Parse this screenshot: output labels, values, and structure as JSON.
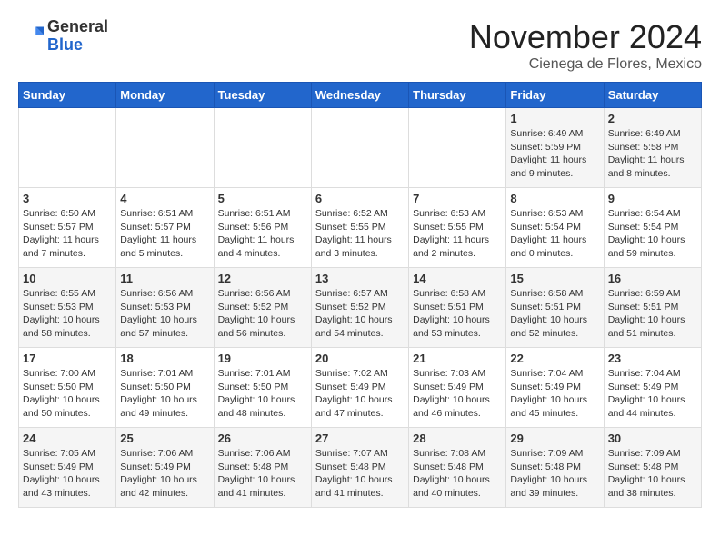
{
  "header": {
    "logo_general": "General",
    "logo_blue": "Blue",
    "month_title": "November 2024",
    "location": "Cienega de Flores, Mexico"
  },
  "weekdays": [
    "Sunday",
    "Monday",
    "Tuesday",
    "Wednesday",
    "Thursday",
    "Friday",
    "Saturday"
  ],
  "weeks": [
    [
      {
        "day": "",
        "info": ""
      },
      {
        "day": "",
        "info": ""
      },
      {
        "day": "",
        "info": ""
      },
      {
        "day": "",
        "info": ""
      },
      {
        "day": "",
        "info": ""
      },
      {
        "day": "1",
        "info": "Sunrise: 6:49 AM\nSunset: 5:59 PM\nDaylight: 11 hours and 9 minutes."
      },
      {
        "day": "2",
        "info": "Sunrise: 6:49 AM\nSunset: 5:58 PM\nDaylight: 11 hours and 8 minutes."
      }
    ],
    [
      {
        "day": "3",
        "info": "Sunrise: 6:50 AM\nSunset: 5:57 PM\nDaylight: 11 hours and 7 minutes."
      },
      {
        "day": "4",
        "info": "Sunrise: 6:51 AM\nSunset: 5:57 PM\nDaylight: 11 hours and 5 minutes."
      },
      {
        "day": "5",
        "info": "Sunrise: 6:51 AM\nSunset: 5:56 PM\nDaylight: 11 hours and 4 minutes."
      },
      {
        "day": "6",
        "info": "Sunrise: 6:52 AM\nSunset: 5:55 PM\nDaylight: 11 hours and 3 minutes."
      },
      {
        "day": "7",
        "info": "Sunrise: 6:53 AM\nSunset: 5:55 PM\nDaylight: 11 hours and 2 minutes."
      },
      {
        "day": "8",
        "info": "Sunrise: 6:53 AM\nSunset: 5:54 PM\nDaylight: 11 hours and 0 minutes."
      },
      {
        "day": "9",
        "info": "Sunrise: 6:54 AM\nSunset: 5:54 PM\nDaylight: 10 hours and 59 minutes."
      }
    ],
    [
      {
        "day": "10",
        "info": "Sunrise: 6:55 AM\nSunset: 5:53 PM\nDaylight: 10 hours and 58 minutes."
      },
      {
        "day": "11",
        "info": "Sunrise: 6:56 AM\nSunset: 5:53 PM\nDaylight: 10 hours and 57 minutes."
      },
      {
        "day": "12",
        "info": "Sunrise: 6:56 AM\nSunset: 5:52 PM\nDaylight: 10 hours and 56 minutes."
      },
      {
        "day": "13",
        "info": "Sunrise: 6:57 AM\nSunset: 5:52 PM\nDaylight: 10 hours and 54 minutes."
      },
      {
        "day": "14",
        "info": "Sunrise: 6:58 AM\nSunset: 5:51 PM\nDaylight: 10 hours and 53 minutes."
      },
      {
        "day": "15",
        "info": "Sunrise: 6:58 AM\nSunset: 5:51 PM\nDaylight: 10 hours and 52 minutes."
      },
      {
        "day": "16",
        "info": "Sunrise: 6:59 AM\nSunset: 5:51 PM\nDaylight: 10 hours and 51 minutes."
      }
    ],
    [
      {
        "day": "17",
        "info": "Sunrise: 7:00 AM\nSunset: 5:50 PM\nDaylight: 10 hours and 50 minutes."
      },
      {
        "day": "18",
        "info": "Sunrise: 7:01 AM\nSunset: 5:50 PM\nDaylight: 10 hours and 49 minutes."
      },
      {
        "day": "19",
        "info": "Sunrise: 7:01 AM\nSunset: 5:50 PM\nDaylight: 10 hours and 48 minutes."
      },
      {
        "day": "20",
        "info": "Sunrise: 7:02 AM\nSunset: 5:49 PM\nDaylight: 10 hours and 47 minutes."
      },
      {
        "day": "21",
        "info": "Sunrise: 7:03 AM\nSunset: 5:49 PM\nDaylight: 10 hours and 46 minutes."
      },
      {
        "day": "22",
        "info": "Sunrise: 7:04 AM\nSunset: 5:49 PM\nDaylight: 10 hours and 45 minutes."
      },
      {
        "day": "23",
        "info": "Sunrise: 7:04 AM\nSunset: 5:49 PM\nDaylight: 10 hours and 44 minutes."
      }
    ],
    [
      {
        "day": "24",
        "info": "Sunrise: 7:05 AM\nSunset: 5:49 PM\nDaylight: 10 hours and 43 minutes."
      },
      {
        "day": "25",
        "info": "Sunrise: 7:06 AM\nSunset: 5:49 PM\nDaylight: 10 hours and 42 minutes."
      },
      {
        "day": "26",
        "info": "Sunrise: 7:06 AM\nSunset: 5:48 PM\nDaylight: 10 hours and 41 minutes."
      },
      {
        "day": "27",
        "info": "Sunrise: 7:07 AM\nSunset: 5:48 PM\nDaylight: 10 hours and 41 minutes."
      },
      {
        "day": "28",
        "info": "Sunrise: 7:08 AM\nSunset: 5:48 PM\nDaylight: 10 hours and 40 minutes."
      },
      {
        "day": "29",
        "info": "Sunrise: 7:09 AM\nSunset: 5:48 PM\nDaylight: 10 hours and 39 minutes."
      },
      {
        "day": "30",
        "info": "Sunrise: 7:09 AM\nSunset: 5:48 PM\nDaylight: 10 hours and 38 minutes."
      }
    ]
  ]
}
